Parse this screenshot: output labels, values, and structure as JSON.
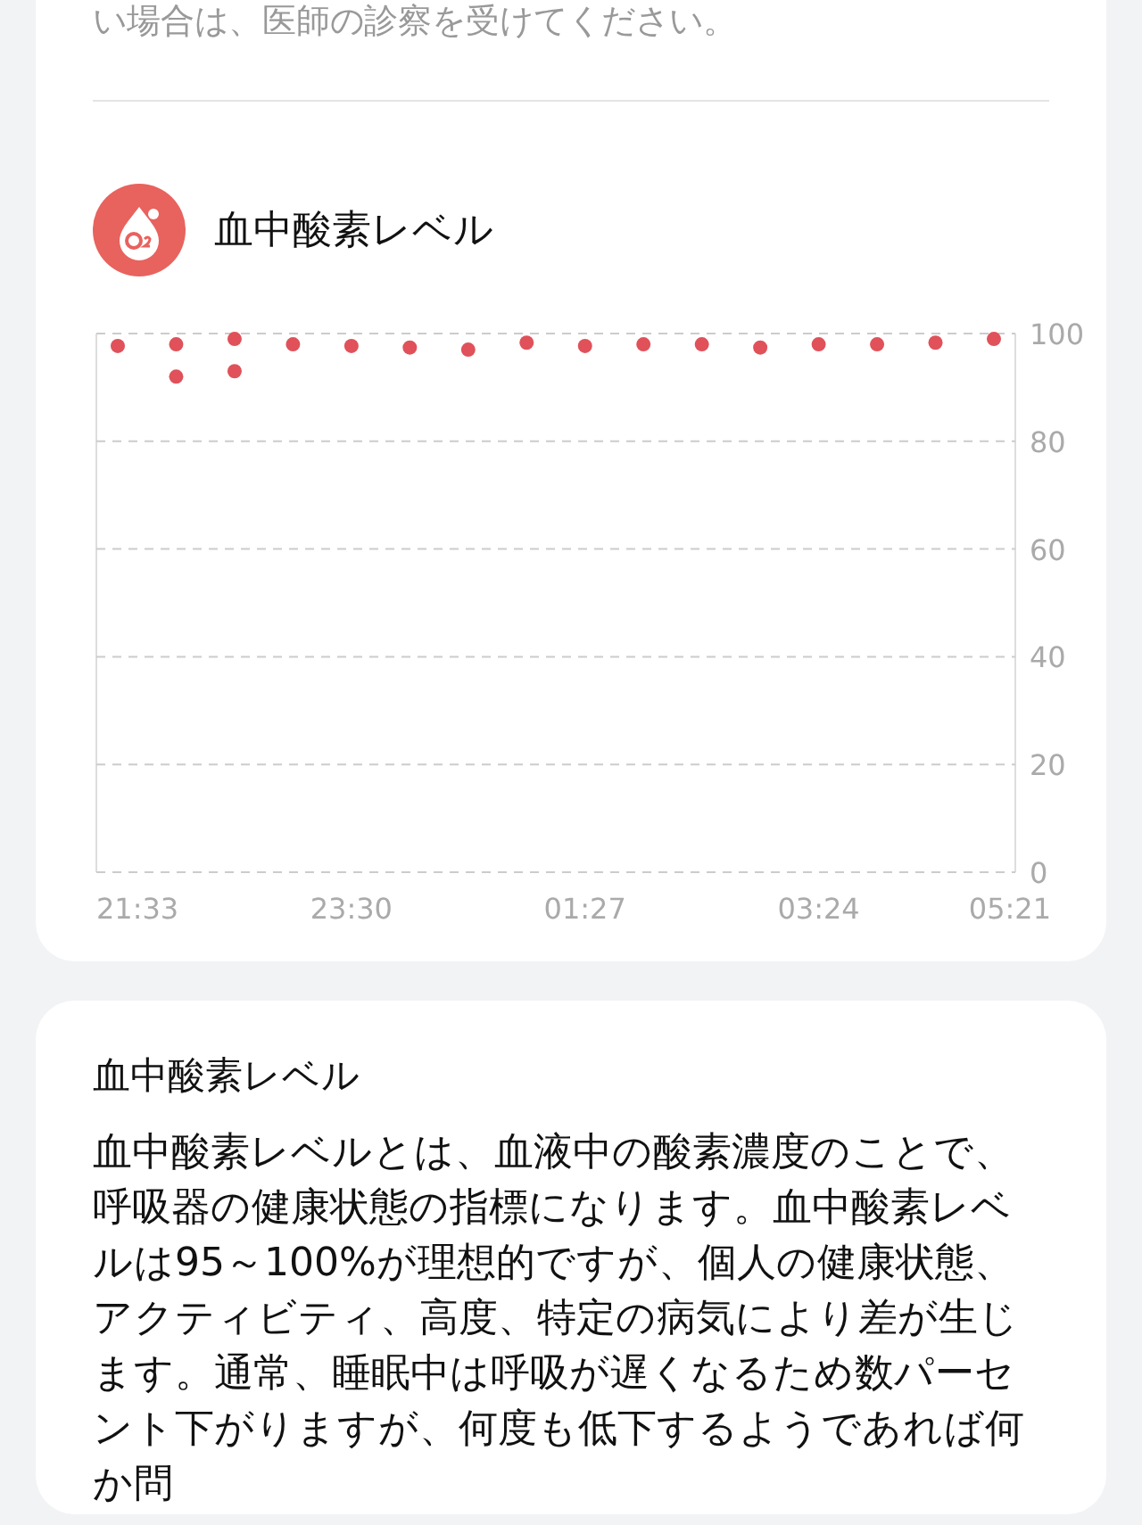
{
  "top_card": {
    "note_tail": "い場合は、医師の診察を受けてください。",
    "section_title": "血中酸素レベル",
    "chart_data": {
      "type": "scatter",
      "grid": true,
      "ylim": [
        0,
        100
      ],
      "categories": [
        "21:33",
        null,
        null,
        null,
        "23:30",
        null,
        null,
        null,
        "01:27",
        null,
        null,
        null,
        "03:24",
        null,
        null,
        "05:21"
      ],
      "yticks": [
        0,
        20,
        40,
        60,
        80,
        100
      ],
      "series": [
        {
          "color": "#e0515a",
          "values": [
            97.7,
            98,
            99,
            98,
            97.7,
            97.4,
            97,
            98.3,
            97.7,
            98,
            98,
            97.4,
            98,
            98,
            98.3,
            99
          ]
        },
        {
          "color": "#e0515a",
          "values": [
            null,
            92,
            93,
            null,
            null,
            null,
            null,
            null,
            null,
            null,
            null,
            null,
            null,
            null,
            null,
            null
          ]
        }
      ]
    }
  },
  "info_card": {
    "title": "血中酸素レベル",
    "body": "血中酸素レベルとは、血液中の酸素濃度のことで、呼吸器の健康状態の指標になります。血中酸素レベルは95～100%が理想的ですが、個人の健康状態、アクティビティ、高度、特定の病気により差が生じます。通常、睡眠中は呼吸が遅くなるため数パーセント下がりますが、何度も低下するようであれば何か問"
  }
}
